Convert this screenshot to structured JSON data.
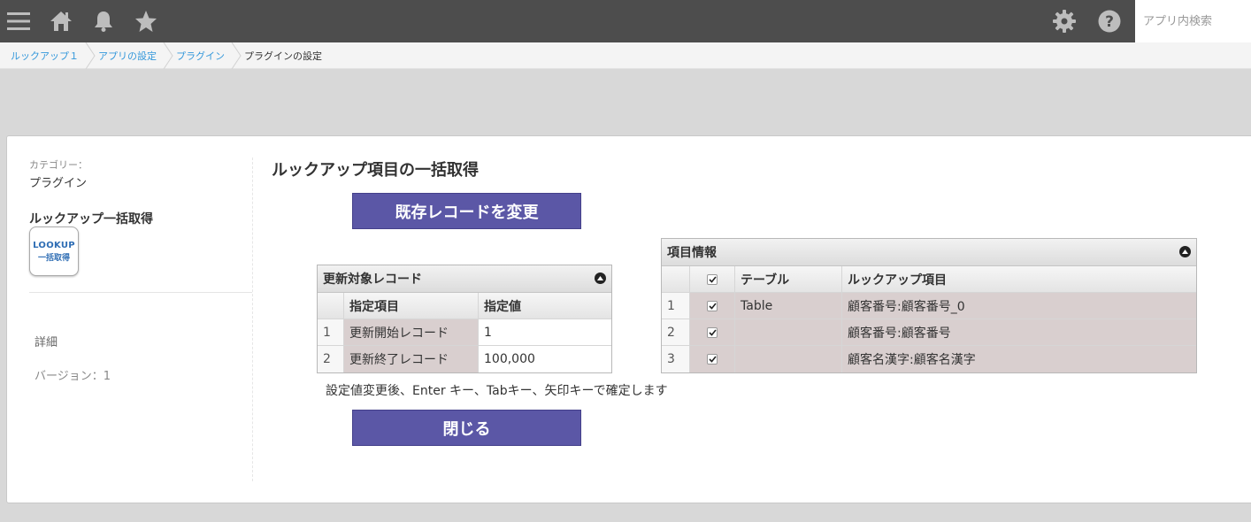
{
  "topbar": {
    "icons": [
      "menu-icon",
      "home-icon",
      "bell-icon",
      "star-icon",
      "gear-icon",
      "help-icon"
    ],
    "search_placeholder": "アプリ内検索"
  },
  "breadcrumb": {
    "items": [
      "ルックアップ１",
      "アプリの設定",
      "プラグイン",
      "プラグインの設定"
    ]
  },
  "sidebar": {
    "category_label": "カテゴリー：",
    "category_value": "プラグイン",
    "plugin_name": "ルックアップ一括取得",
    "logo_line1": "LOOKUP",
    "logo_line2": "一括取得",
    "details_link": "詳細",
    "version": "バージョン：1"
  },
  "main": {
    "title": "ルックアップ項目の一括取得",
    "change_button": "既存レコードを変更",
    "close_button": "閉じる",
    "hint": "設定値変更後、Enter キー、Tabキー、矢印キーで確定します"
  },
  "update_grid": {
    "title": "更新対象レコード",
    "headers": [
      "指定項目",
      "指定値"
    ],
    "rows": [
      {
        "num": "1",
        "label": "更新開始レコード",
        "value": "1"
      },
      {
        "num": "2",
        "label": "更新終了レコード",
        "value": "100,000"
      }
    ]
  },
  "item_grid": {
    "title": "項目情報",
    "headers": [
      "テーブル",
      "ルックアップ項目"
    ],
    "rows": [
      {
        "num": "1",
        "table": "Table",
        "lookup": "顧客番号:顧客番号_0"
      },
      {
        "num": "2",
        "table": "",
        "lookup": "顧客番号:顧客番号"
      },
      {
        "num": "3",
        "table": "",
        "lookup": "顧客名漢字:顧客名漢字"
      }
    ]
  },
  "colors": {
    "topbar": "#4d4d4d",
    "button": "#5b57a6",
    "link": "#3498db",
    "shaded_cell": "#d9cfcf"
  }
}
